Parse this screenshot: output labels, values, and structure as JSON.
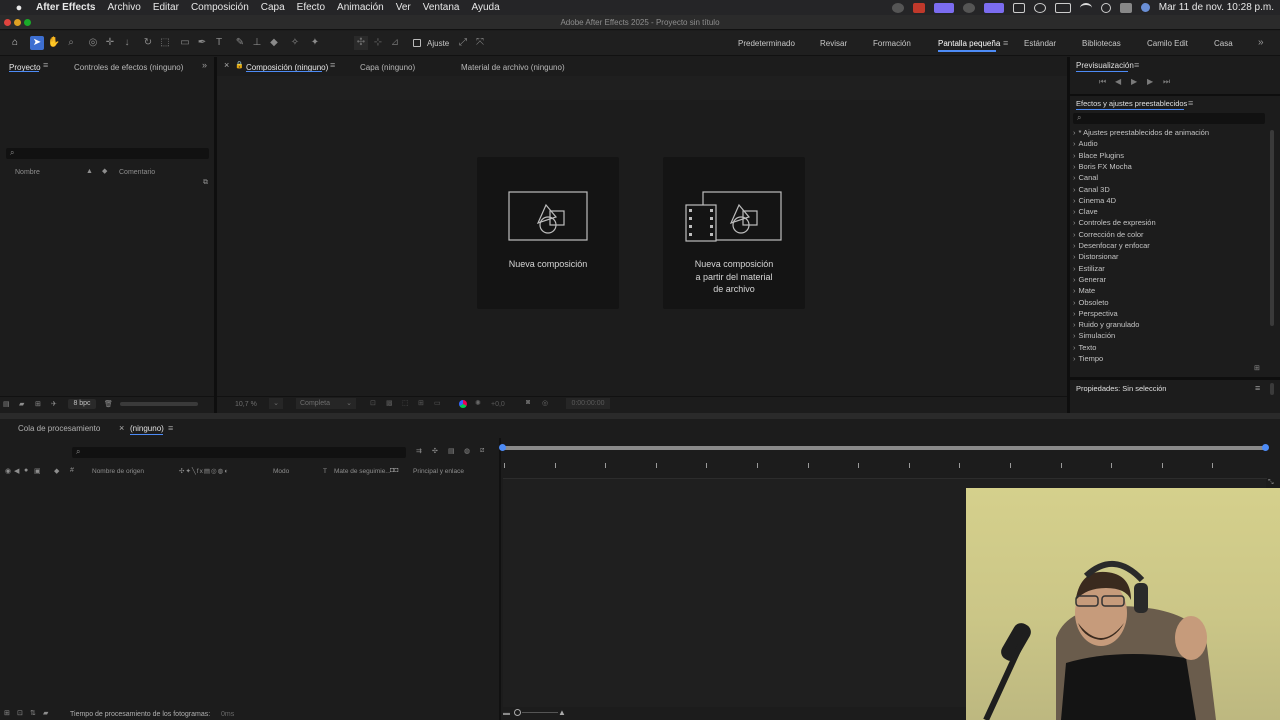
{
  "menubar": {
    "app_name": "After Effects",
    "items": [
      "Archivo",
      "Editar",
      "Composición",
      "Capa",
      "Efecto",
      "Animación",
      "Ver",
      "Ventana",
      "Ayuda"
    ],
    "datetime": "Mar 11 de nov.  10:28 p.m."
  },
  "window": {
    "title": "Adobe After Effects 2025 - Proyecto sin título"
  },
  "toolbar": {
    "snap_label": "Ajuste",
    "workspaces": [
      "Predeterminado",
      "Revisar",
      "Formación",
      "Pantalla pequeña",
      "Estándar",
      "Bibliotecas",
      "Camilo Edit",
      "Casa"
    ],
    "active_workspace": "Pantalla pequeña"
  },
  "project_panel": {
    "tabs": [
      "Proyecto",
      "Controles de efectos (ninguno)"
    ],
    "columns": {
      "name": "Nombre",
      "comment": "Comentario"
    },
    "bpc": "8 bpc"
  },
  "comp_panel": {
    "tabs": [
      "Composición (ninguno)",
      "Capa (ninguno)",
      "Material de archivo (ninguno)"
    ],
    "new_comp": "Nueva composición",
    "new_comp_from_footage": [
      "Nueva composición",
      "a partir del material",
      "de archivo"
    ],
    "zoom": "10,7 %",
    "resolution": "Completa",
    "exposure": "+0,0",
    "timecode": "0:00:00:00"
  },
  "preview_panel": {
    "title": "Previsualización"
  },
  "effects_panel": {
    "title": "Efectos y ajustes preestablecidos",
    "items": [
      "* Ajustes preestablecidos de animación",
      "Audio",
      "Blace Plugins",
      "Boris FX Mocha",
      "Canal",
      "Canal 3D",
      "Cinema 4D",
      "Clave",
      "Controles de expresión",
      "Corrección de color",
      "Desenfocar y enfocar",
      "Distorsionar",
      "Estilizar",
      "Generar",
      "Mate",
      "Obsoleto",
      "Perspectiva",
      "Ruido y granulado",
      "Simulación",
      "Texto",
      "Tiempo"
    ]
  },
  "properties_panel": {
    "title": "Propiedades: Sin selección"
  },
  "timeline": {
    "tabs": [
      "Cola de procesamiento",
      "(ninguno)"
    ],
    "columns": {
      "source": "Nombre de origen",
      "mode": "Modo",
      "t": "T",
      "track_matte": "Mate de seguimie...",
      "parent": "Principal y enlace"
    },
    "render_time_label": "Tiempo de procesamiento de los fotogramas:",
    "render_time_value": "0ms"
  },
  "colors": {
    "accent": "#4d8bf6",
    "panel": "#1c1c1c",
    "card": "#141414"
  }
}
